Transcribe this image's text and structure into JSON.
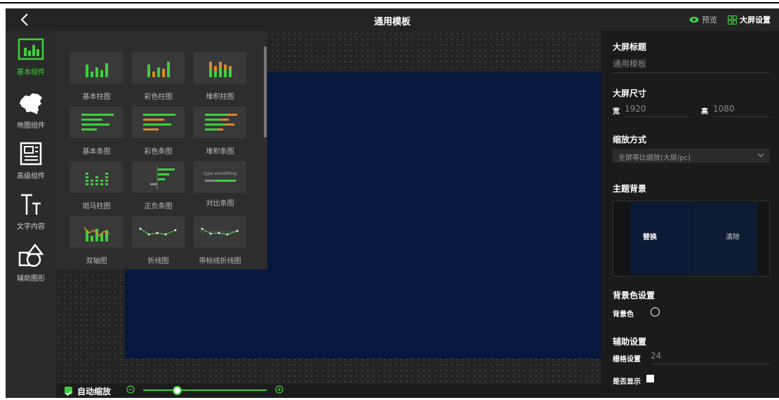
{
  "header": {
    "title": "通用模板",
    "preview_label": "预览",
    "settings_label": "大屏设置"
  },
  "nav": [
    {
      "label": "基本组件",
      "icon": "bar-chart-icon",
      "active": true
    },
    {
      "label": "地图组件",
      "icon": "china-map-icon"
    },
    {
      "label": "高级组件",
      "icon": "document-icon"
    },
    {
      "label": "文字内容",
      "icon": "text-icon"
    },
    {
      "label": "辅助图形",
      "icon": "shapes-icon"
    }
  ],
  "components": [
    {
      "label": "基本柱图",
      "icon": "basic-column-chart-icon"
    },
    {
      "label": "彩色柱图",
      "icon": "color-column-chart-icon"
    },
    {
      "label": "堆积柱图",
      "icon": "stacked-column-chart-icon"
    },
    {
      "label": "基本条图",
      "icon": "basic-bar-chart-icon"
    },
    {
      "label": "彩色条图",
      "icon": "color-bar-chart-icon"
    },
    {
      "label": "堆积条图",
      "icon": "stacked-bar-chart-icon"
    },
    {
      "label": "斑马柱图",
      "icon": "zebra-column-chart-icon"
    },
    {
      "label": "正负条图",
      "icon": "pos-neg-bar-chart-icon"
    },
    {
      "label": "对比条图",
      "icon": "compare-bar-chart-icon",
      "thumb_text": "type something"
    },
    {
      "label": "双轴图",
      "icon": "dual-axis-chart-icon"
    },
    {
      "label": "折线图",
      "icon": "line-chart-icon"
    },
    {
      "label": "带标线折线图",
      "icon": "marked-line-chart-icon"
    }
  ],
  "settings": {
    "screen_title_heading": "大屏标题",
    "screen_title_value": "通用模板",
    "size_heading": "大屏尺寸",
    "width_label": "宽",
    "width_value": "1920",
    "height_label": "高",
    "height_value": "1080",
    "scale_heading": "缩放方式",
    "scale_value": "全屏等比缩放(大屏/pc)",
    "theme_heading": "主题背景",
    "replace_label": "替换",
    "clear_label": "清除",
    "bgcolor_heading": "背景色设置",
    "bgcolor_label": "背景色",
    "aux_heading": "辅助设置",
    "grid_label": "栅格设置",
    "grid_value": "24",
    "show_label": "是否显示"
  },
  "bottom": {
    "auto_zoom_label": "自动缩放",
    "auto_zoom_checked": true,
    "zoom_level": 0.27
  },
  "colors": {
    "accent": "#3ecf3e",
    "canvas": "#07183f",
    "orange": "#d9892b"
  }
}
